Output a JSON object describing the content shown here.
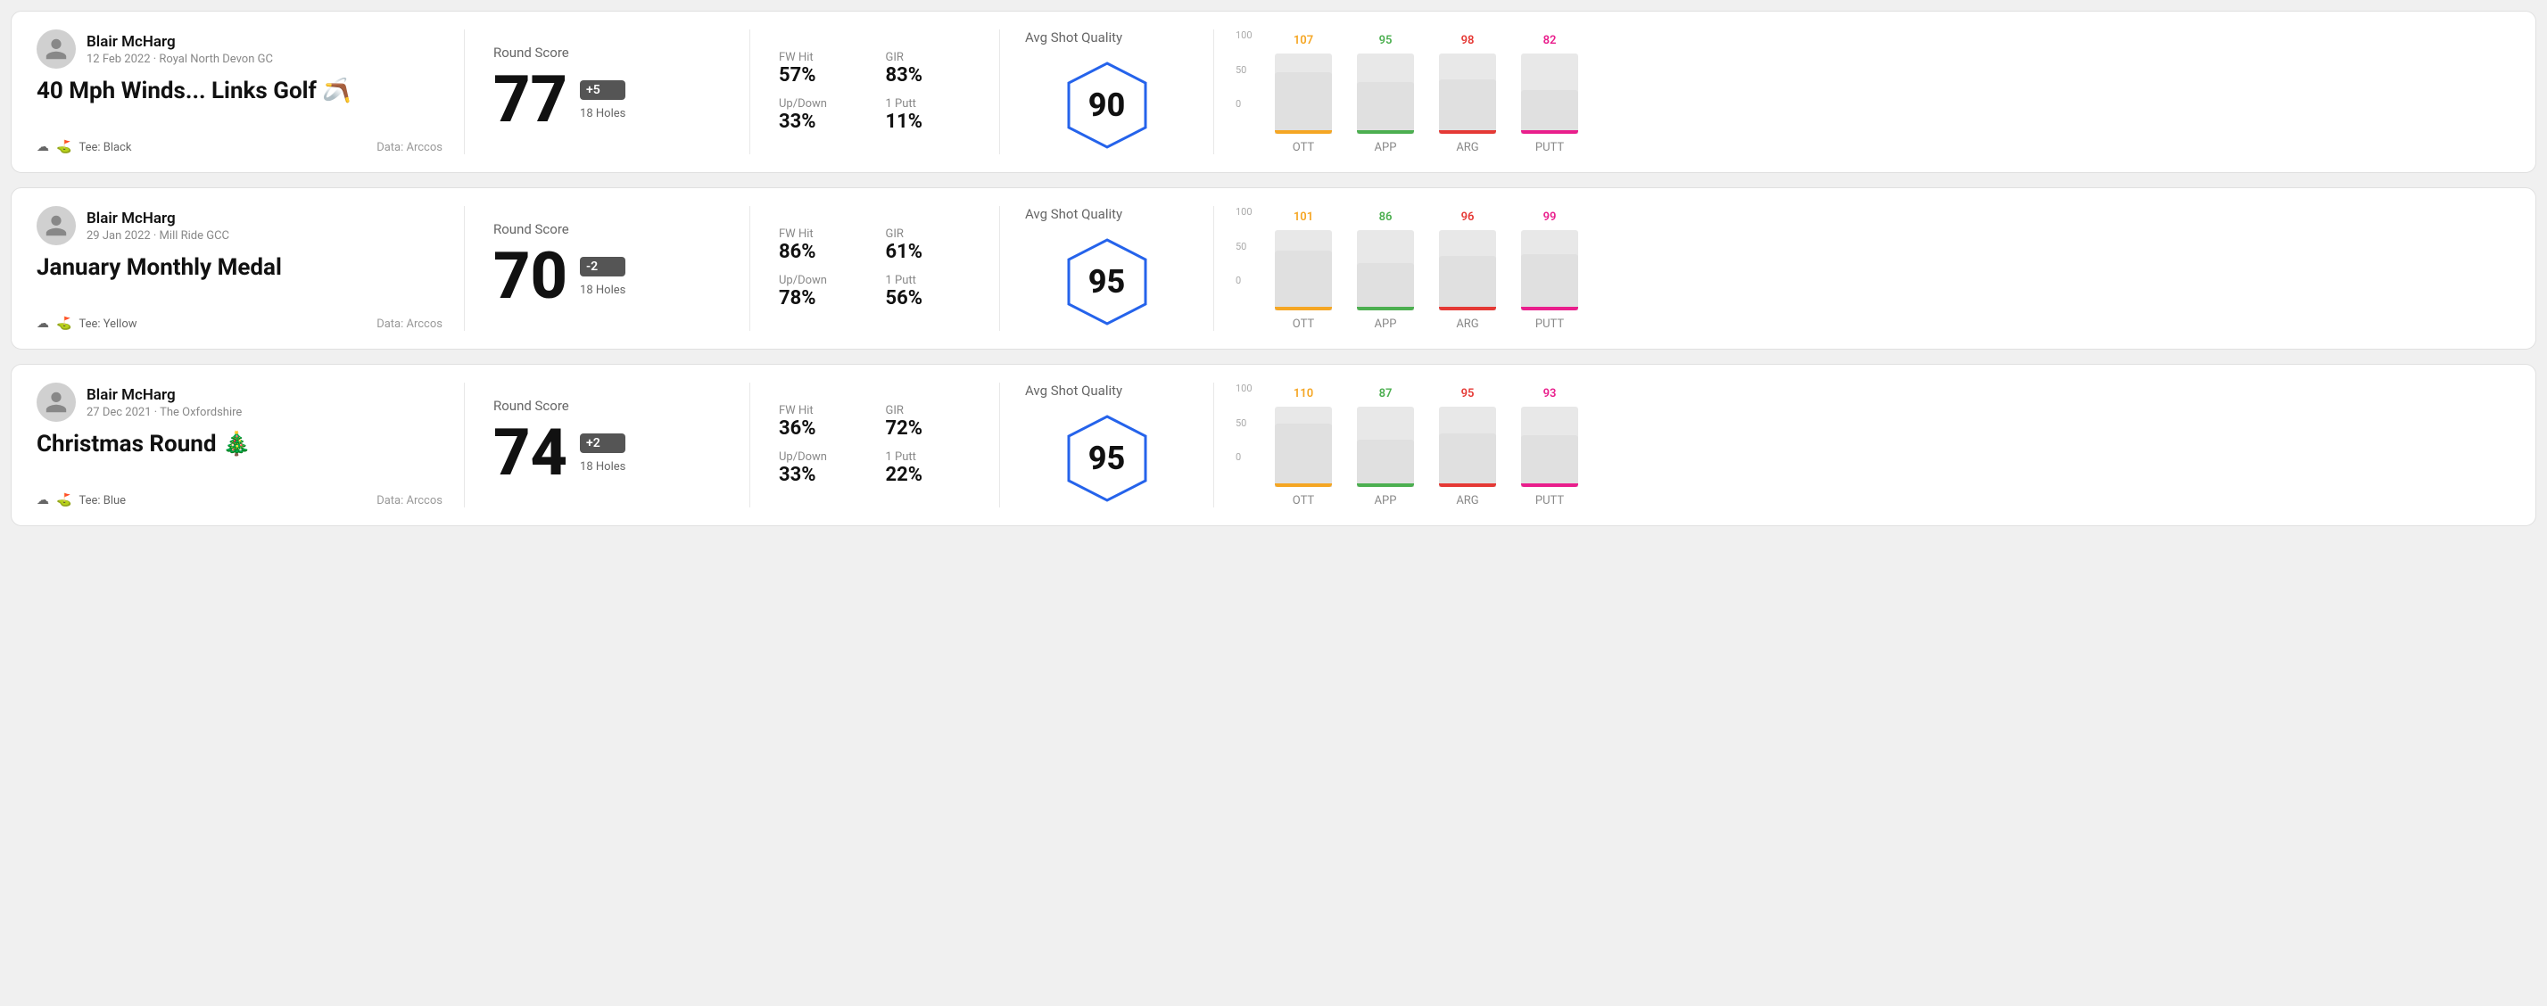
{
  "rounds": [
    {
      "id": "round1",
      "user": {
        "name": "Blair McHarg",
        "date": "12 Feb 2022 · Royal North Devon GC"
      },
      "title": "40 Mph Winds... Links Golf 🪃",
      "tee": "Black",
      "data_source": "Data: Arccos",
      "round_score_label": "Round Score",
      "score": "77",
      "badge": "+5",
      "holes": "18 Holes",
      "fw_hit_label": "FW Hit",
      "fw_hit_value": "57%",
      "gir_label": "GIR",
      "gir_value": "83%",
      "updown_label": "Up/Down",
      "updown_value": "33%",
      "oneputt_label": "1 Putt",
      "oneputt_value": "11%",
      "quality_label": "Avg Shot Quality",
      "quality_score": "90",
      "chart": {
        "bars": [
          {
            "label": "OTT",
            "value": 107,
            "color": "#f5a623",
            "fill_pct": 85
          },
          {
            "label": "APP",
            "value": 95,
            "color": "#4caf50",
            "fill_pct": 72
          },
          {
            "label": "ARG",
            "value": 98,
            "color": "#e53935",
            "fill_pct": 76
          },
          {
            "label": "PUTT",
            "value": 82,
            "color": "#e91e8c",
            "fill_pct": 60
          }
        ]
      }
    },
    {
      "id": "round2",
      "user": {
        "name": "Blair McHarg",
        "date": "29 Jan 2022 · Mill Ride GCC"
      },
      "title": "January Monthly Medal",
      "tee": "Yellow",
      "data_source": "Data: Arccos",
      "round_score_label": "Round Score",
      "score": "70",
      "badge": "-2",
      "holes": "18 Holes",
      "fw_hit_label": "FW Hit",
      "fw_hit_value": "86%",
      "gir_label": "GIR",
      "gir_value": "61%",
      "updown_label": "Up/Down",
      "updown_value": "78%",
      "oneputt_label": "1 Putt",
      "oneputt_value": "56%",
      "quality_label": "Avg Shot Quality",
      "quality_score": "95",
      "chart": {
        "bars": [
          {
            "label": "OTT",
            "value": 101,
            "color": "#f5a623",
            "fill_pct": 82
          },
          {
            "label": "APP",
            "value": 86,
            "color": "#4caf50",
            "fill_pct": 65
          },
          {
            "label": "ARG",
            "value": 96,
            "color": "#e53935",
            "fill_pct": 75
          },
          {
            "label": "PUTT",
            "value": 99,
            "color": "#e91e8c",
            "fill_pct": 78
          }
        ]
      }
    },
    {
      "id": "round3",
      "user": {
        "name": "Blair McHarg",
        "date": "27 Dec 2021 · The Oxfordshire"
      },
      "title": "Christmas Round 🎄",
      "tee": "Blue",
      "data_source": "Data: Arccos",
      "round_score_label": "Round Score",
      "score": "74",
      "badge": "+2",
      "holes": "18 Holes",
      "fw_hit_label": "FW Hit",
      "fw_hit_value": "36%",
      "gir_label": "GIR",
      "gir_value": "72%",
      "updown_label": "Up/Down",
      "updown_value": "33%",
      "oneputt_label": "1 Putt",
      "oneputt_value": "22%",
      "quality_label": "Avg Shot Quality",
      "quality_score": "95",
      "chart": {
        "bars": [
          {
            "label": "OTT",
            "value": 110,
            "color": "#f5a623",
            "fill_pct": 88
          },
          {
            "label": "APP",
            "value": 87,
            "color": "#4caf50",
            "fill_pct": 66
          },
          {
            "label": "ARG",
            "value": 95,
            "color": "#e53935",
            "fill_pct": 74
          },
          {
            "label": "PUTT",
            "value": 93,
            "color": "#e91e8c",
            "fill_pct": 72
          }
        ]
      }
    }
  ],
  "y_axis": {
    "top": "100",
    "mid": "50",
    "bot": "0"
  }
}
